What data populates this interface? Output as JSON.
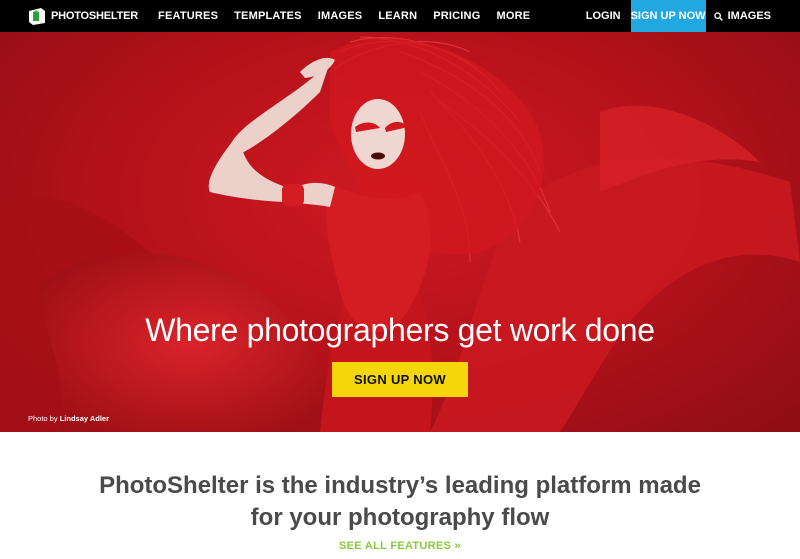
{
  "nav": {
    "logo_text": "PHOTOSHELTER",
    "links": [
      "FEATURES",
      "TEMPLATES",
      "IMAGES",
      "LEARN",
      "PRICING",
      "MORE"
    ],
    "login": "LOGIN",
    "signup": "SIGN UP NOW",
    "images_search": "IMAGES",
    "signup_color": "#22a7e0"
  },
  "hero": {
    "title": "Where photographers get work done",
    "cta": "SIGN UP NOW",
    "cta_color": "#f5d60b",
    "credit_prefix": "Photo by",
    "credit_name": "Lindsay Adler"
  },
  "intro": {
    "line1": "PhotoShelter is the industry’s leading platform made",
    "line2": "for your photography flow",
    "link": "SEE ALL FEATURES »",
    "link_color": "#8cc63f"
  }
}
